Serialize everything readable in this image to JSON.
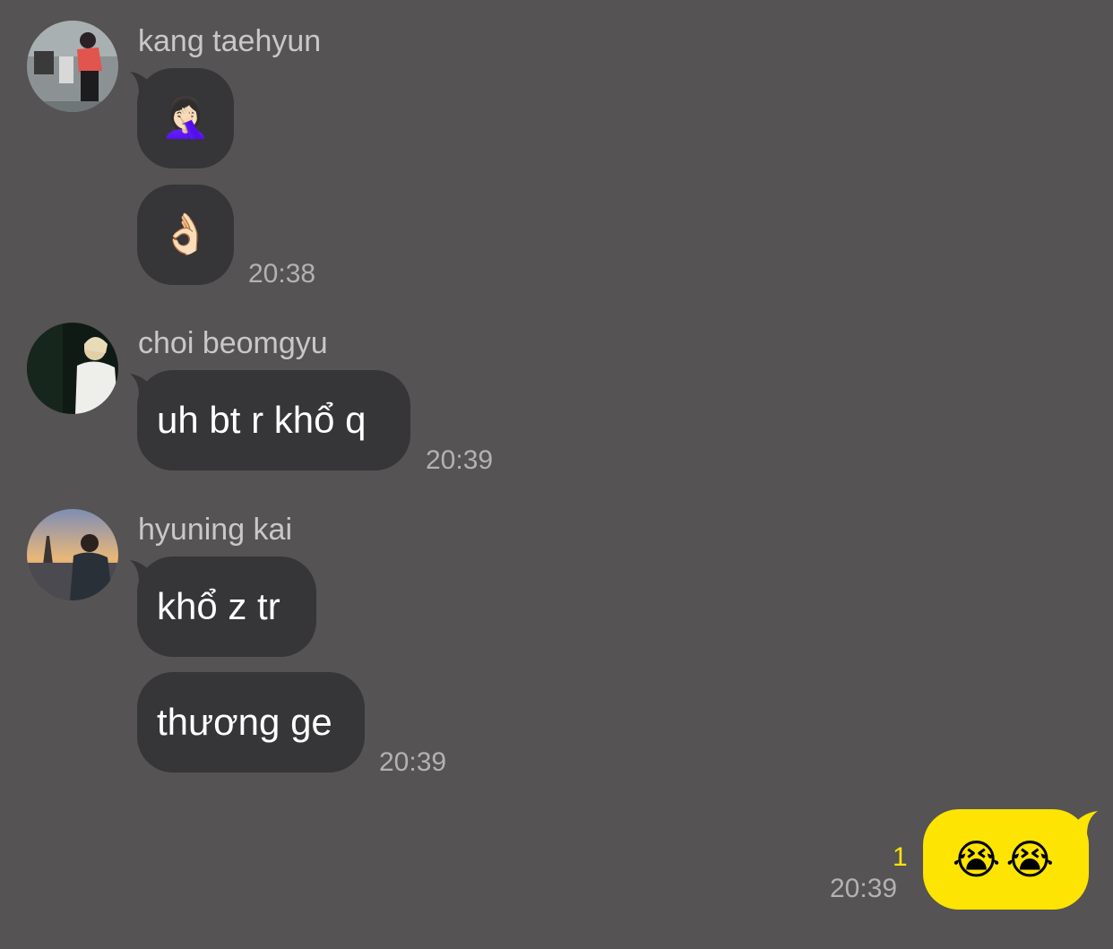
{
  "messages": [
    {
      "sender": "kang taehyun",
      "avatar_icon": "profile-photo-red-shirt",
      "bubbles": [
        "🤦🏻‍♀️",
        "👌🏻"
      ],
      "time": "20:38"
    },
    {
      "sender": "choi beomgyu",
      "avatar_icon": "profile-photo-dark-portrait",
      "bubbles": [
        "uh bt r khổ q"
      ],
      "time": "20:39"
    },
    {
      "sender": "hyuning kai",
      "avatar_icon": "profile-photo-eiffel-sunset",
      "bubbles": [
        "khổ z tr",
        "thương ge"
      ],
      "time": "20:39"
    }
  ],
  "my_message": {
    "text": "😭😭",
    "unread_count": "1",
    "time": "20:39",
    "bubble_color": "#fde402"
  },
  "colors": {
    "background": "#555354",
    "incoming_bubble": "#363537",
    "name_text": "#c9c7c8",
    "time_text": "#b3b1b2"
  }
}
